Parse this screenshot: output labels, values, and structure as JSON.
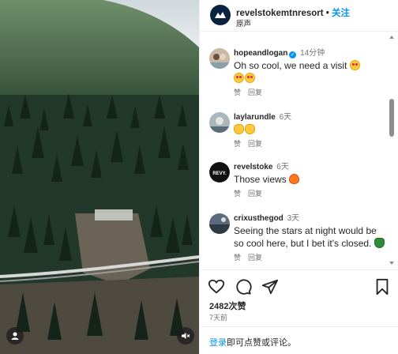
{
  "post": {
    "username": "revelstokemtnresort",
    "separator": "•",
    "follow_label": "关注",
    "audio_label": "原声",
    "likes": "2482次赞",
    "posted_ago": "7天前",
    "login_link": "登录",
    "login_rest": "即可点赞或评论。"
  },
  "comments": [
    {
      "user": "hopeandlogan",
      "verified": true,
      "time": "14分钟",
      "text": "Oh so cool, we need a visit",
      "emojis": [
        "heart-eyes",
        "heart-eyes",
        "heart-eyes"
      ],
      "like": "赞",
      "reply": "回复"
    },
    {
      "user": "laylarundle",
      "verified": false,
      "time": "6天",
      "text": "",
      "emojis": [
        "clap",
        "clap"
      ],
      "like": "赞",
      "reply": "回复"
    },
    {
      "user": "revelstoke",
      "verified": false,
      "time": "6天",
      "text": "Those views",
      "emojis": [
        "fire"
      ],
      "like": "赞",
      "reply": "回复",
      "avatar_text": "REVY."
    },
    {
      "user": "crixusthegod",
      "verified": false,
      "time": "3天",
      "text": "Seeing the stars at night would be so cool here, but I bet it's closed.",
      "emojis": [
        "tree"
      ],
      "like": "赞",
      "reply": "回复"
    }
  ],
  "colors": {
    "accent": "#0095f6",
    "text": "#262626",
    "muted": "#737373"
  },
  "icons": [
    "heart-icon",
    "comment-icon",
    "share-icon",
    "bookmark-icon",
    "mute-icon",
    "user-tag-icon"
  ]
}
